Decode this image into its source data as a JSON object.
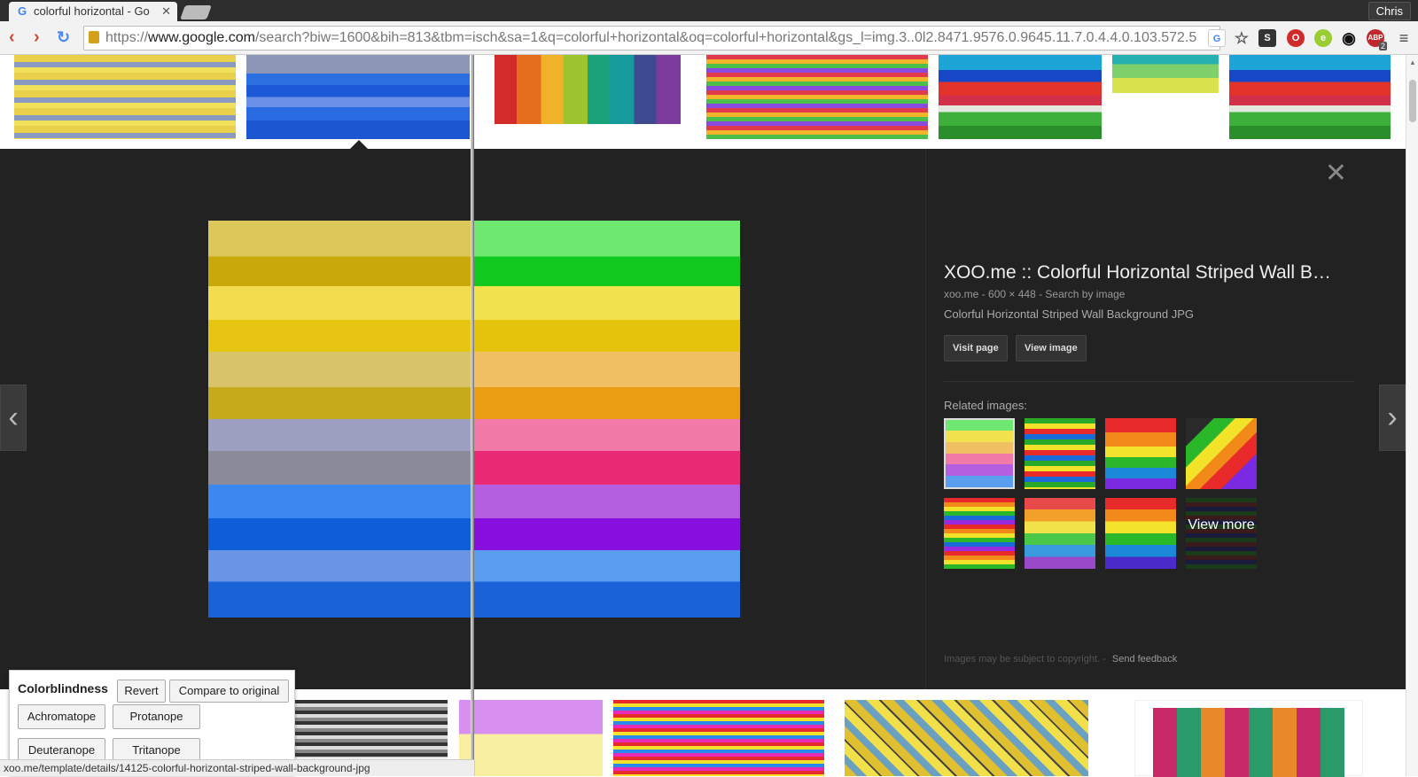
{
  "browser": {
    "tab_title": "colorful horizontal - Go",
    "user": "Chris",
    "url_prefix": "https://",
    "url_host": "www.google.com",
    "url_path": "/search?biw=1600&bih=813&tbm=isch&sa=1&q=colorful+horizontal&oq=colorful+horizontal&gs_l=img.3..0l2.8471.9576.0.9645.11.7.0.4.4.0.103.572.5",
    "abp_badge": "2"
  },
  "detail": {
    "title": "XOO.me :: Colorful Horizontal Striped Wall B…",
    "source": "xoo.me",
    "dimensions": "600 × 448",
    "search_by_image": "Search by image",
    "description": "Colorful Horizontal Striped Wall Background JPG",
    "visit_page": "Visit page",
    "view_image": "View image",
    "related_label": "Related images:",
    "view_more": "View more",
    "copyright": "Images may be subject to copyright.",
    "send_feedback": "Send feedback"
  },
  "colorblindness": {
    "title": "Colorblindness",
    "revert": "Revert",
    "compare": "Compare to original",
    "achromatope": "Achromatope",
    "protanope": "Protanope",
    "deuteranope": "Deuteranope",
    "tritanope": "Tritanope"
  },
  "status_url": "xoo.me/template/details/14125-colorful-horizontal-striped-wall-background-jpg"
}
